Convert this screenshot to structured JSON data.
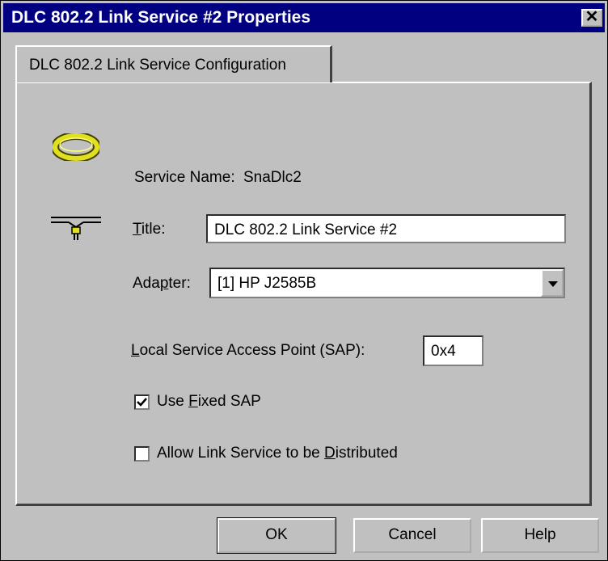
{
  "window": {
    "title": "DLC 802.2 Link Service #2 Properties",
    "close_label": "✕"
  },
  "tab": {
    "label": "DLC 802.2 Link Service Configuration"
  },
  "form": {
    "service_name_label": "Service Name:",
    "service_name_value": "SnaDlc2",
    "title_label_first": "T",
    "title_label_rest": "itle:",
    "title_value": "DLC 802.2 Link Service #2",
    "adapter_label_pre": "Ada",
    "adapter_label_accel": "p",
    "adapter_label_post": "ter:",
    "adapter_value": "[1] HP J2585B",
    "sap_label_first": "L",
    "sap_label_rest": "ocal Service Access Point (SAP):",
    "sap_value": "0x4",
    "use_fixed_sap": {
      "label_pre": "Use ",
      "label_accel": "F",
      "label_post": "ixed SAP",
      "checked": true
    },
    "allow_distributed": {
      "label_pre": "Allow Link Service to be ",
      "label_accel": "D",
      "label_post": "istributed",
      "checked": false
    }
  },
  "icons": {
    "ring": "ring-network-icon",
    "connector": "network-connector-icon"
  },
  "buttons": {
    "ok": "OK",
    "cancel": "Cancel",
    "help": "Help"
  },
  "checkmark": "✓"
}
